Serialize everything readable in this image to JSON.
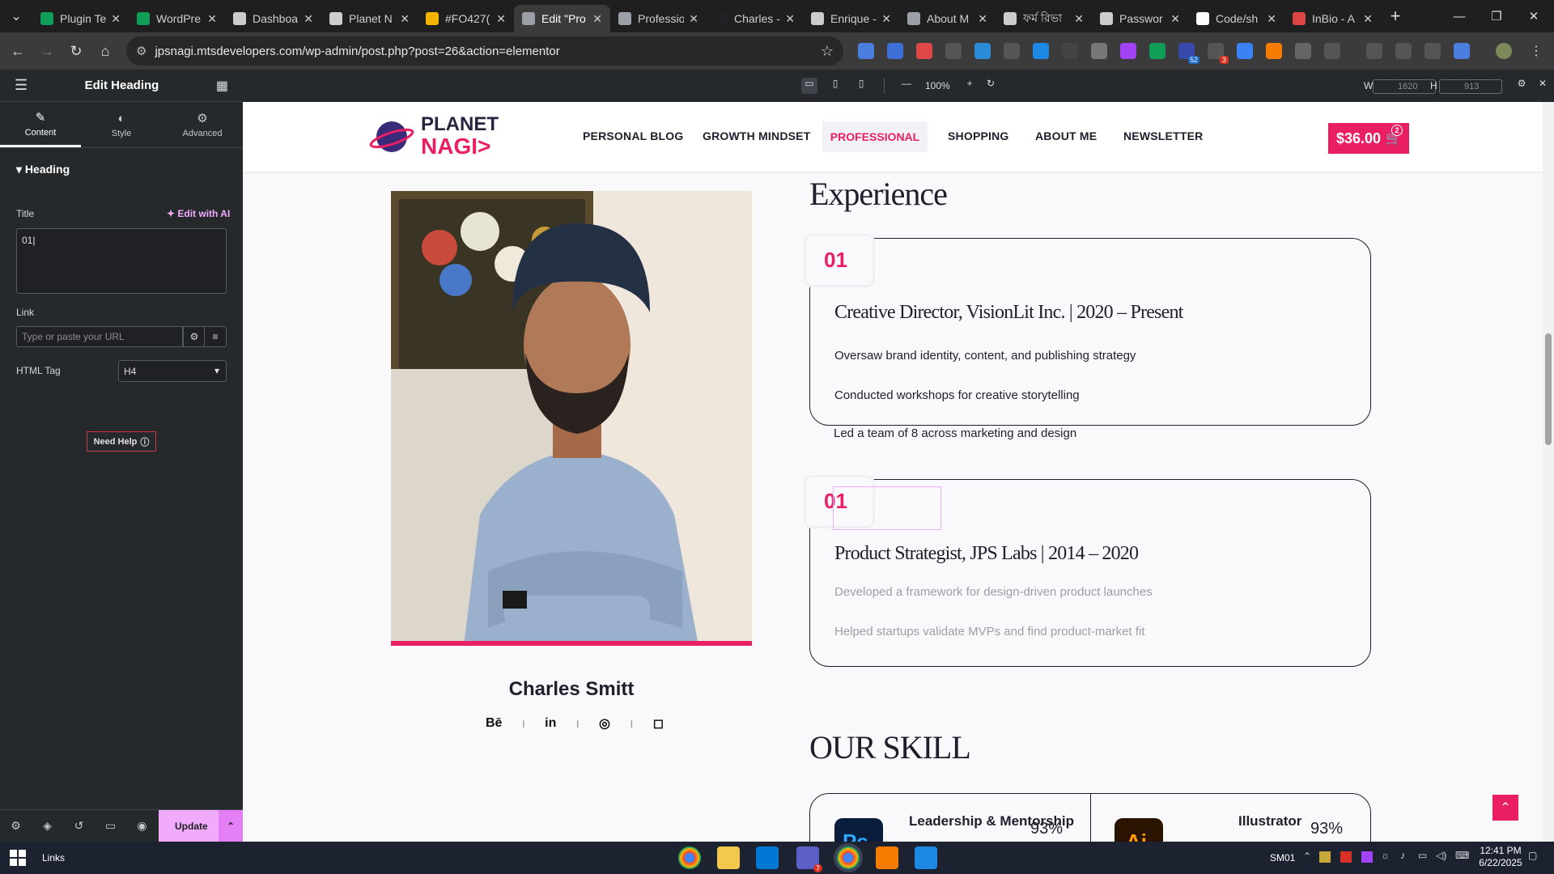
{
  "browser": {
    "tabs": [
      {
        "label": "Plugin Te",
        "color": "#0f9d58"
      },
      {
        "label": "WordPre",
        "color": "#0f9d58"
      },
      {
        "label": "Dashboa",
        "color": "#cccccc"
      },
      {
        "label": "Planet N",
        "color": "#cccccc"
      },
      {
        "label": "#FO427(",
        "color": "#f4b400"
      },
      {
        "label": "Edit \"Pro",
        "color": "#9aa0a6"
      },
      {
        "label": "Professio",
        "color": "#9aa0a6"
      },
      {
        "label": "Charles -",
        "color": "#202124"
      },
      {
        "label": "Enrique -",
        "color": "#cccccc"
      },
      {
        "label": "About M",
        "color": "#9aa0a6"
      },
      {
        "label": "ফর্ম রিভা",
        "color": "#cccccc"
      },
      {
        "label": "Passwor",
        "color": "#cccccc"
      },
      {
        "label": "Code/sh",
        "color": "#ffffff"
      },
      {
        "label": "InBio - A",
        "color": "#d44"
      }
    ],
    "url": "jpsnagi.mtsdevelopers.com/wp-admin/post.php?post=26&action=elementor",
    "badges": {
      "ext_a": "52",
      "ext_b": "3"
    }
  },
  "panel": {
    "header_title": "Edit Heading",
    "tabs": [
      "Content",
      "Style",
      "Advanced"
    ],
    "section_title": "Heading",
    "title_label": "Title",
    "edit_ai": "Edit with AI",
    "title_value": "01|",
    "link_label": "Link",
    "link_placeholder": "Type or paste your URL",
    "html_tag_label": "HTML Tag",
    "html_tag_value": "H4",
    "need_help": "Need Help",
    "update": "Update"
  },
  "preview": {
    "zoom": "100%",
    "width_label": "W",
    "width_value": "1620",
    "height_label": "H",
    "height_value": "913"
  },
  "site": {
    "logo_top": "PLANET",
    "logo_bottom": "NAGI>",
    "menu": [
      "PERSONAL BLOG",
      "GROWTH MINDSET",
      "PROFESSIONAL",
      "SHOPPING",
      "ABOUT ME",
      "NEWSLETTER"
    ],
    "cart_total": "$36.00",
    "cart_count": "2",
    "person_name": "Charles Smitt",
    "socials": [
      "Bē",
      "in",
      "◎",
      "◻"
    ],
    "experience_title": "Experience",
    "jobs": [
      {
        "number": "01",
        "title": "Creative Director, VisionLit Inc. | 2020 – Present",
        "bullets": [
          "Oversaw brand identity, content, and publishing strategy",
          "Conducted workshops for creative storytelling",
          "Led a team of 8 across marketing and design"
        ]
      },
      {
        "number": "01",
        "title": "Product Strategist, JPS Labs | 2014 – 2020",
        "bullets": [
          "Developed a framework for design-driven product launches",
          "Helped startups validate MVPs and find product-market fit"
        ]
      }
    ],
    "skills_title": "OUR SKILL",
    "skills": [
      {
        "icon": "Ps",
        "name": "Leadership & Mentorship",
        "percent": "93%"
      },
      {
        "icon": "Ai",
        "name": "Illustrator",
        "percent": "93%"
      }
    ]
  },
  "taskbar": {
    "links_label": "Links",
    "sm_label": "SM01",
    "time": "12:41 PM",
    "date": "6/22/2025",
    "vscode_badge": "7"
  }
}
